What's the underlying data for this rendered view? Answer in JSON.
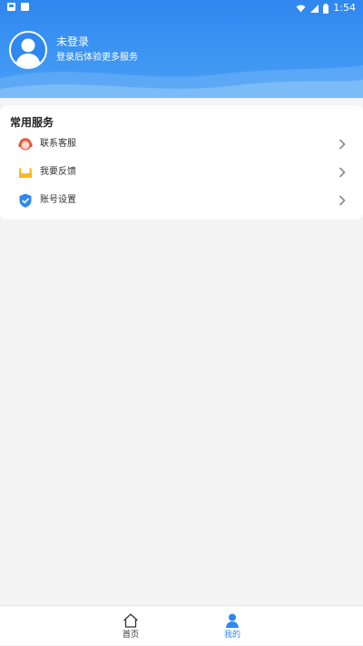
{
  "status_bar": {
    "time": "1:54"
  },
  "user": {
    "title": "未登录",
    "subtitle": "登录后体验更多服务"
  },
  "services": {
    "title": "常用服务",
    "items": [
      {
        "label": "联系客服",
        "icon": "customer-service-icon"
      },
      {
        "label": "我要反馈",
        "icon": "feedback-mail-icon"
      },
      {
        "label": "账号设置",
        "icon": "shield-check-icon"
      }
    ]
  },
  "nav": {
    "items": [
      {
        "label": "首页",
        "icon": "home-icon",
        "active": false
      },
      {
        "label": "我的",
        "icon": "person-icon",
        "active": true
      }
    ]
  },
  "colors": {
    "primary": "#2f87f0",
    "background": "#f4f4f4",
    "card": "#ffffff"
  }
}
